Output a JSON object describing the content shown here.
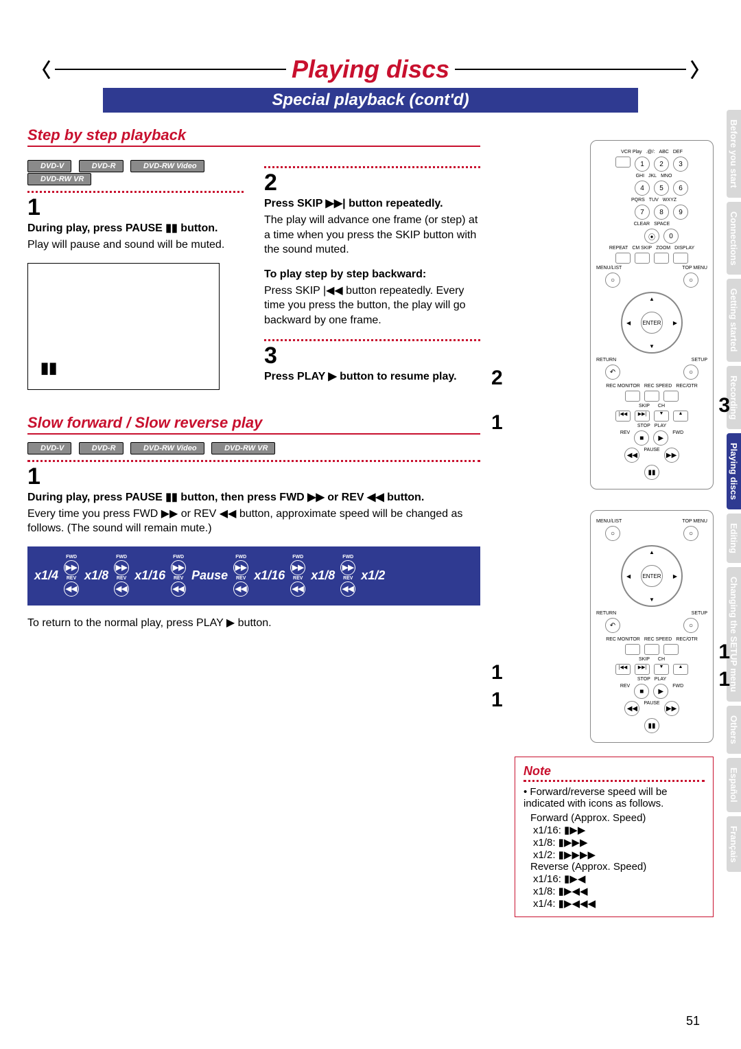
{
  "header": {
    "title": "Playing discs",
    "subtitle": "Special playback (cont'd)"
  },
  "section1": {
    "title": "Step by step playback",
    "badges": [
      "DVD-V",
      "DVD-R",
      "DVD-RW Video",
      "DVD-RW VR"
    ],
    "step1_num": "1",
    "step1_instr": "During play, press PAUSE ▮▮ button.",
    "step1_body": "Play will pause and sound will be muted.",
    "step2_num": "2",
    "step2_instr": "Press SKIP ▶▶| button repeatedly.",
    "step2_body": "The play will advance one frame (or step) at a time when you press the SKIP button with the sound muted.",
    "back_title": "To play step by step backward:",
    "back_body": "Press SKIP |◀◀ button repeatedly. Every time you press the button, the play will go backward by one frame.",
    "step3_num": "3",
    "step3_instr": "Press PLAY ▶ button to resume play."
  },
  "section2": {
    "title": "Slow forward / Slow reverse play",
    "badges": [
      "DVD-V",
      "DVD-R",
      "DVD-RW Video",
      "DVD-RW VR"
    ],
    "step1_num": "1",
    "step1_instr": "During play, press PAUSE ▮▮ button, then press FWD ▶▶ or REV ◀◀ button.",
    "step1_body": "Every time you press FWD ▶▶ or REV ◀◀ button, approximate speed will be changed as follows. (The sound will remain mute.)",
    "speeds_rev": [
      "x1/4",
      "x1/8",
      "x1/16"
    ],
    "pause_label": "Pause",
    "speeds_fwd": [
      "x1/16",
      "x1/8",
      "x1/2"
    ],
    "return_text": "To return to the normal play, press PLAY ▶ button."
  },
  "remote": {
    "row1": [
      "1",
      "2",
      "3"
    ],
    "row1_lbl": [
      ".@/:",
      "ABC",
      "DEF"
    ],
    "row2": [
      "4",
      "5",
      "6"
    ],
    "row2_lbl": [
      "GHI",
      "JKL",
      "MNO"
    ],
    "row3": [
      "7",
      "8",
      "9"
    ],
    "row3_lbl": [
      "PQRS",
      "TUV",
      "WXYZ"
    ],
    "row4_lbl": [
      "CLEAR",
      "SPACE"
    ],
    "zero": "0",
    "row5_lbl": [
      "REPEAT",
      "CM SKIP",
      "ZOOM",
      "DISPLAY"
    ],
    "menulist": "MENU/LIST",
    "topmenu": "TOP MENU",
    "enter": "ENTER",
    "return": "RETURN",
    "setup": "SETUP",
    "rec_lbls": [
      "REC MONITOR",
      "REC SPEED",
      "REC/OTR"
    ],
    "trans_lbls": [
      "SKIP",
      "CH"
    ],
    "trans2_lbls": [
      "STOP",
      "PLAY"
    ],
    "trans3_lbls": [
      "REV",
      "FWD"
    ],
    "pause_lbl": "PAUSE",
    "vcrplay": "VCR Play"
  },
  "callouts_top": {
    "c1": "1",
    "c2": "2",
    "c3": "3"
  },
  "callouts_bot": {
    "c1a": "1",
    "c1b": "1",
    "c1c": "1",
    "c1d": "1"
  },
  "note": {
    "title": "Note",
    "body": "Forward/reverse speed will be indicated with icons as follows.",
    "fwd_label": "Forward (Approx. Speed)",
    "fwd": [
      "x1/16: ▮▶▶",
      "x1/8:  ▮▶▶▶",
      "x1/2:  ▮▶▶▶▶"
    ],
    "rev_label": "Reverse (Approx. Speed)",
    "rev": [
      "x1/16: ▮▶◀",
      "x1/8:  ▮▶◀◀",
      "x1/4:  ▮▶◀◀◀"
    ]
  },
  "tabs": [
    "Before you start",
    "Connections",
    "Getting started",
    "Recording",
    "Playing discs",
    "Editing",
    "Changing the SETUP menu",
    "Others",
    "Español",
    "Français"
  ],
  "active_tab": "Playing discs",
  "page": "51"
}
